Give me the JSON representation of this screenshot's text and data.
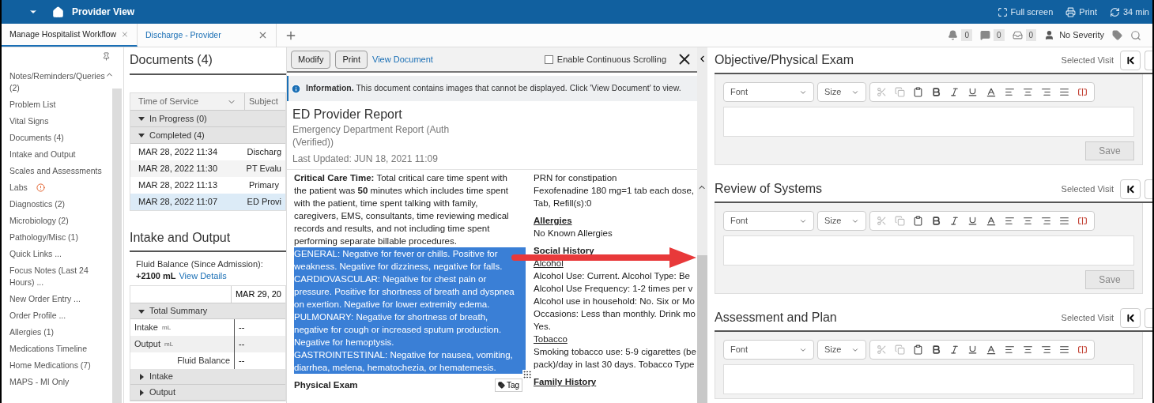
{
  "header": {
    "title": "Provider View",
    "actions": [
      {
        "kind": "fullscreen",
        "label": "Full screen"
      },
      {
        "kind": "print",
        "label": "Print"
      },
      {
        "kind": "refresh",
        "label": "34 min"
      }
    ]
  },
  "tabs": [
    {
      "label": "Manage Hospitalist Workflow",
      "selected": true
    },
    {
      "label": "Discharge - Provider",
      "selected": false
    }
  ],
  "indicators": [
    {
      "kind": "bell",
      "count": "0"
    },
    {
      "kind": "message",
      "count": "0"
    },
    {
      "kind": "inbox",
      "count": "0"
    }
  ],
  "severity": "No Severity",
  "sidebar": {
    "items": [
      {
        "label": "Notes/Reminders/Queries (2)",
        "alert": false
      },
      {
        "label": "Problem List",
        "alert": false
      },
      {
        "label": "Vital Signs",
        "alert": false
      },
      {
        "label": "Documents (4)",
        "alert": false
      },
      {
        "label": "Intake and Output",
        "alert": false
      },
      {
        "label": "Scales and Assessments",
        "alert": false
      },
      {
        "label": "Labs",
        "alert": true
      },
      {
        "label": "Diagnostics (2)",
        "alert": false
      },
      {
        "label": "Microbiology (2)",
        "alert": false
      },
      {
        "label": "Pathology/Misc (1)",
        "alert": false
      },
      {
        "label": "Quick Links ...",
        "alert": false
      },
      {
        "label": "Focus Notes (Last 24 Hours) ...",
        "alert": false
      },
      {
        "label": "New Order Entry ...",
        "alert": false
      },
      {
        "label": "Order Profile ...",
        "alert": false
      },
      {
        "label": "Allergies (1)",
        "alert": false
      },
      {
        "label": "Medications Timeline",
        "alert": false
      },
      {
        "label": "Home Medications (7)",
        "alert": false
      },
      {
        "label": "MAPS - MI Only",
        "alert": false
      }
    ]
  },
  "documents": {
    "title": "Documents (4)",
    "columns": [
      "Time of Service",
      "Subject"
    ],
    "groups": [
      {
        "label": "In Progress (0)",
        "expanded": true
      },
      {
        "label": "Completed (4)",
        "expanded": true,
        "rows": [
          {
            "time": "MAR 28, 2022 11:34",
            "subject": "Discharg",
            "selected": false
          },
          {
            "time": "MAR 28, 2022 11:30",
            "subject": "PT Evalu",
            "selected": false
          },
          {
            "time": "MAR 28, 2022 11:13",
            "subject": "Primary",
            "selected": false
          },
          {
            "time": "MAR 28, 2022 11:07",
            "subject": "ED Provi",
            "selected": true
          }
        ]
      }
    ]
  },
  "intake": {
    "title": "Intake and Output",
    "fluid_label": "Fluid Balance (Since Admission):",
    "fluid_value": "+2100 mL",
    "link": "View Details",
    "date_column": "MAR 29, 20",
    "rows": [
      {
        "kind": "group",
        "label": "Total Summary",
        "expanded": true
      },
      {
        "kind": "row",
        "label": "Intake",
        "unit": "mL",
        "value": "--"
      },
      {
        "kind": "row",
        "label": "Output",
        "unit": "mL",
        "value": "--"
      },
      {
        "kind": "total",
        "label": "Fluid Balance",
        "value": "--"
      },
      {
        "kind": "group",
        "label": "Intake",
        "expanded": false
      },
      {
        "kind": "group",
        "label": "Output",
        "expanded": false
      }
    ]
  },
  "viewer": {
    "buttons": [
      "Modify",
      "Print"
    ],
    "link": "View Document",
    "continuous_scrolling": {
      "label": "Enable Continuous Scrolling",
      "checked": false
    },
    "info": "**Information.** This document contains images that cannot be displayed. Click 'View Document' to view.",
    "title": "ED Provider Report",
    "subtitle": "Emergency Department Report (Auth (Verified))",
    "updated": "Last Updated: JUN 18, 2021 11:09",
    "left_blocks": [
      {
        "text": "**Critical Care Time:** Total critical care time spent with the patient was **50** minutes which includes time spent with the patient, time spent talking with family, caregivers, EMS, consultants, time reviewing medical records and results, and not including time spent performing separate billable procedures.",
        "selected": false
      },
      {
        "text": "GENERAL: Negative for fever or chills. Positive for weakness. Negative for dizziness, negative for falls.",
        "selected": true
      },
      {
        "text": "CARDIOVASCULAR: Negative for chest pain or pressure. Positive for shortness of breath and dyspnea on exertion. Negative for lower extremity edema.",
        "selected": true
      },
      {
        "text": "PULMONARY:  Negative for shortness of breath, negative for cough or increased sputum production. Negative for hemoptysis.",
        "selected": true
      },
      {
        "text": "GASTROINTESTINAL: Negative for nausea, vomiting, diarrhea, melena, hematochezia, or hematemesis.",
        "selected": true
      }
    ],
    "left_heading": "Physical Exam",
    "tag_button": "Tag",
    "right_lines": [
      {
        "kind": "text",
        "text": "PRN for constipation"
      },
      {
        "kind": "text",
        "text": "Fexofenadine 180 mg=1 tab each dose,"
      },
      {
        "kind": "text",
        "text": "Tab, Refill(s):0"
      },
      {
        "kind": "heading",
        "text": "Allergies"
      },
      {
        "kind": "text",
        "text": "No Known Allergies"
      },
      {
        "kind": "heading",
        "text": "Social History"
      },
      {
        "kind": "subheading",
        "text": "Alcohol"
      },
      {
        "kind": "text",
        "text": "Alcohol Use: Current. Alcohol Type: Be"
      },
      {
        "kind": "text",
        "text": "Alcohol Use Frequency: 1-2 times per v"
      },
      {
        "kind": "text",
        "text": "Alcohol use in household: No. Six or Mo"
      },
      {
        "kind": "text",
        "text": "Occasions: Less than monthly. Drink mo"
      },
      {
        "kind": "text",
        "text": "Yes."
      },
      {
        "kind": "subheading",
        "text": "Tobacco"
      },
      {
        "kind": "text",
        "text": "Smoking tobacco use: 5-9 cigarettes (be"
      },
      {
        "kind": "text",
        "text": "pack)/day in last 30 days. Tobacco Type"
      },
      {
        "kind": "heading",
        "text": "Family History"
      }
    ]
  },
  "sections": [
    {
      "title": "Objective/Physical Exam",
      "visit_label": "Selected Visit",
      "font": "Font",
      "size": "Size",
      "save": "Save"
    },
    {
      "title": "Review of Systems",
      "visit_label": "Selected Visit",
      "font": "Font",
      "size": "Size",
      "save": "Save"
    },
    {
      "title": "Assessment and Plan",
      "visit_label": "Selected Visit",
      "font": "Font",
      "size": "Size"
    }
  ]
}
